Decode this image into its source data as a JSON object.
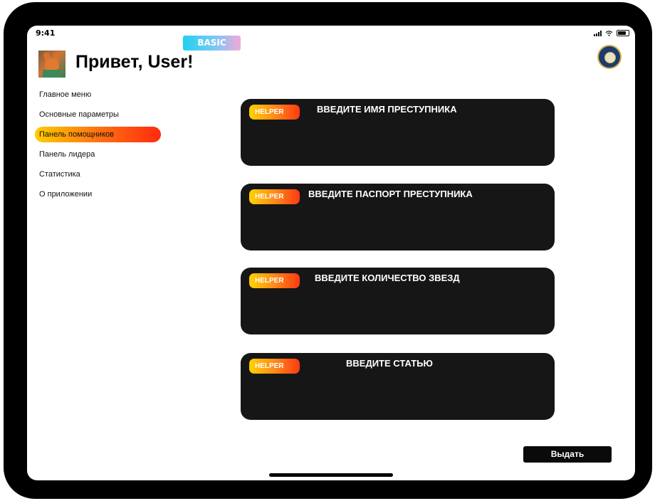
{
  "status_bar": {
    "time": "9:41"
  },
  "plan_badge": "BASIC",
  "header": {
    "greeting": "Привет, User!"
  },
  "menu": {
    "items": [
      {
        "label": "Главное меню",
        "active": false
      },
      {
        "label": "Основные параметры",
        "active": false
      },
      {
        "label": "Панель помощников",
        "active": true
      },
      {
        "label": "Панель лидера",
        "active": false
      },
      {
        "label": "Статистика",
        "active": false
      },
      {
        "label": "О приложении",
        "active": false
      }
    ]
  },
  "cards": [
    {
      "badge": "HELPER",
      "title": "ВВЕДИТЕ ИМЯ ПРЕСТУПНИКА"
    },
    {
      "badge": "HELPER",
      "title": "ВВЕДИТЕ ПАСПОРТ ПРЕСТУПНИКА"
    },
    {
      "badge": "HELPER",
      "title": "ВВЕДИТЕ КОЛИЧЕСТВО ЗВЕЗД"
    },
    {
      "badge": "HELPER",
      "title": "ВВЕДИТЕ СТАТЬЮ"
    }
  ],
  "actions": {
    "issue_label": "Выдать"
  },
  "colors": {
    "card_bg": "#161616",
    "accent_gradient_start": "#ffcc00",
    "accent_gradient_end": "#ff2a10",
    "plan_gradient_start": "#1fd1f0",
    "plan_gradient_end": "#f3a9d8"
  },
  "icons": {
    "avatar": "fox-avatar",
    "seal": "government-seal-icon",
    "status": [
      "signal-icon",
      "wifi-icon",
      "battery-icon"
    ]
  }
}
